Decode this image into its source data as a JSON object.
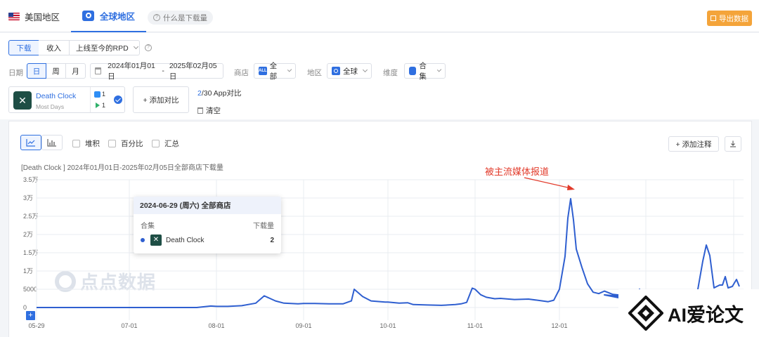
{
  "header": {
    "tab_us": "美国地区",
    "tab_global": "全球地区",
    "help": "什么是下载量",
    "export": "导出数据"
  },
  "filters": {
    "metric_download": "下载",
    "metric_revenue": "收入",
    "rpd": "上线至今的RPD",
    "date_label": "日期",
    "gran_day": "日",
    "gran_week": "周",
    "gran_month": "月",
    "date_start": "2024年01月01日",
    "date_sep": "-",
    "date_end": "2025年02月05日",
    "store_label": "商店",
    "store_badge": "ALL",
    "store_value": "全部",
    "region_label": "地区",
    "region_value": "全球",
    "dimension_label": "维度",
    "dimension_value": "合集"
  },
  "app": {
    "name": "Death Clock",
    "sub": "Most Days",
    "ios_count": "1",
    "android_count": "1",
    "add_compare": "+ 添加对比",
    "compare_count": "2",
    "compare_total": "/30 App对比",
    "clear": "清空"
  },
  "chart_toolbar": {
    "stack": "堆积",
    "percent": "百分比",
    "summary": "汇总",
    "add_annotation": "+ 添加注释"
  },
  "chart_title": "[Death Clock ] 2024年01月01日-2025年02月05日全部商店下载量",
  "annotation": "被主流媒体报道",
  "watermark": "点点数据",
  "tooltip": {
    "date": "2024-06-29 (周六) 全部商店",
    "col_left": "合集",
    "col_right": "下载量",
    "row_name": "Death Clock",
    "row_value": "2"
  },
  "logo": {
    "text": "AI爱论文"
  },
  "colors": {
    "accent": "#2f6fe0",
    "line": "#2f5fd0",
    "export": "#f4a43a",
    "annotation": "#e23a2a"
  },
  "chart_data": {
    "type": "line",
    "title": "[Death Clock ] 2024年01月01日-2025年02月05日全部商店下载量",
    "xlabel": "",
    "ylabel": "",
    "y_ticks": [
      "0",
      "5000",
      "1万",
      "1.5万",
      "2万",
      "2.5万",
      "3万",
      "3.5万"
    ],
    "y_tick_values": [
      0,
      5000,
      10000,
      15000,
      20000,
      25000,
      30000,
      35000
    ],
    "ylim": [
      0,
      35000
    ],
    "x_ticks": [
      "05-29",
      "07-01",
      "08-01",
      "09-01",
      "10-01",
      "11-01",
      "12-01"
    ],
    "grid": true,
    "series": [
      {
        "name": "Death Clock",
        "x": [
          "05-29",
          "06-10",
          "06-20",
          "06-29",
          "07-05",
          "07-15",
          "07-25",
          "07-30",
          "08-01",
          "08-05",
          "08-10",
          "08-15",
          "08-18",
          "08-20",
          "08-22",
          "08-25",
          "08-30",
          "09-01",
          "09-05",
          "09-10",
          "09-15",
          "09-18",
          "09-19",
          "09-22",
          "09-25",
          "09-30",
          "10-01",
          "10-05",
          "10-08",
          "10-10",
          "10-15",
          "10-20",
          "10-25",
          "10-27",
          "10-29",
          "10-31",
          "11-01",
          "11-03",
          "11-05",
          "11-08",
          "11-10",
          "11-15",
          "11-20",
          "11-25",
          "11-27",
          "11-29",
          "12-01",
          "12-03",
          "12-04",
          "12-05",
          "12-06",
          "12-07",
          "12-09",
          "12-11",
          "12-13",
          "12-15",
          "12-17",
          "12-20",
          "12-25",
          "12-28",
          "12-30"
        ],
        "values": [
          0,
          0,
          0,
          2,
          0,
          0,
          0,
          400,
          300,
          300,
          500,
          1200,
          3200,
          2500,
          1800,
          1200,
          1000,
          1100,
          1100,
          1000,
          1000,
          1800,
          5000,
          3000,
          1800,
          1500,
          1500,
          1200,
          1300,
          800,
          700,
          600,
          800,
          1000,
          1400,
          5300,
          5000,
          3500,
          2800,
          2400,
          2500,
          2200,
          2300,
          1800,
          1600,
          2000,
          5000,
          14000,
          24500,
          29800,
          24000,
          16000,
          11000,
          6500,
          4200,
          3800,
          4500,
          3600,
          3200,
          2700,
          2500
        ]
      }
    ]
  }
}
